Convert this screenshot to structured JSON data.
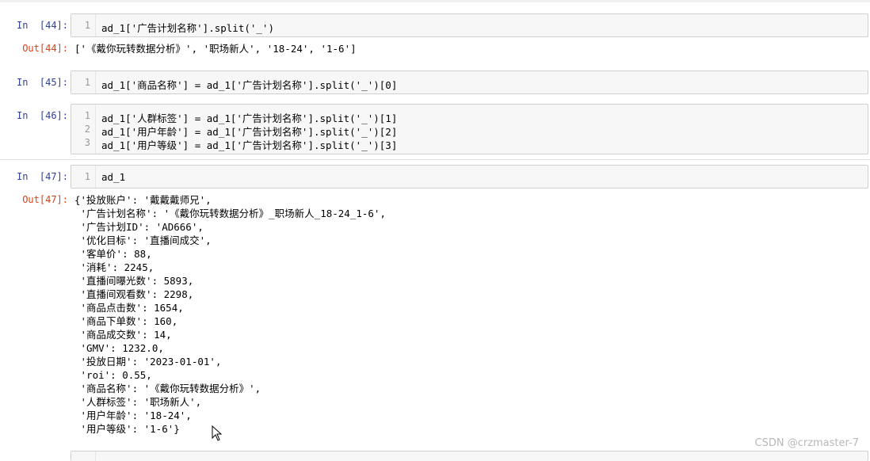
{
  "cells": [
    {
      "in_prompt": "In  [44]:",
      "lines": [
        {
          "n": "1",
          "code": "ad_1['广告计划名称'].split('_')"
        }
      ],
      "out_prompt": "Out[44]:",
      "output": [
        "['《戴你玩转数据分析》', '职场新人', '18-24', '1-6']"
      ]
    },
    {
      "in_prompt": "In  [45]:",
      "lines": [
        {
          "n": "1",
          "code": "ad_1['商品名称'] = ad_1['广告计划名称'].split('_')[0]"
        }
      ]
    },
    {
      "in_prompt": "In  [46]:",
      "lines": [
        {
          "n": "1",
          "code": "ad_1['人群标签'] = ad_1['广告计划名称'].split('_')[1]"
        },
        {
          "n": "2",
          "code": "ad_1['用户年龄'] = ad_1['广告计划名称'].split('_')[2]"
        },
        {
          "n": "3",
          "code": "ad_1['用户等级'] = ad_1['广告计划名称'].split('_')[3]"
        }
      ]
    },
    {
      "in_prompt": "In  [47]:",
      "lines": [
        {
          "n": "1",
          "code": "ad_1"
        }
      ],
      "out_prompt": "Out[47]:",
      "output": [
        "{'投放账户': '戴戴戴师兄',",
        " '广告计划名称': '《戴你玩转数据分析》_职场新人_18-24_1-6',",
        " '广告计划ID': 'AD666',",
        " '优化目标': '直播间成交',",
        " '客单价': 88,",
        " '消耗': 2245,",
        " '直播间曝光数': 5893,",
        " '直播间观看数': 2298,",
        " '商品点击数': 1654,",
        " '商品下单数': 160,",
        " '商品成交数': 14,",
        " 'GMV': 1232.0,",
        " '投放日期': '2023-01-01',",
        " 'roi': 0.55,",
        " '商品名称': '《戴你玩转数据分析》',",
        " '人群标签': '职场新人',",
        " '用户年龄': '18-24',",
        " '用户等级': '1-6'}"
      ]
    }
  ],
  "watermark": "CSDN @crzmaster-7"
}
